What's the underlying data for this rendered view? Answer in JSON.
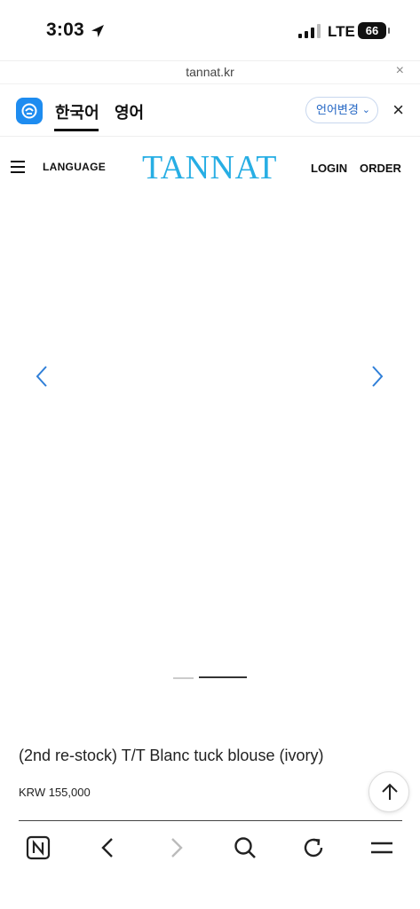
{
  "status_bar": {
    "time": "3:03",
    "network": "LTE",
    "battery": "66"
  },
  "url_bar": {
    "domain": "tannat.kr",
    "close": "×"
  },
  "translate_bar": {
    "tabs": [
      {
        "label": "한국어"
      },
      {
        "label": "영어"
      }
    ],
    "change_language": "언어변경",
    "close": "×"
  },
  "site_header": {
    "language_link": "LANGUAGE",
    "brand": "TANNAT",
    "login": "LOGIN",
    "order": "ORDER"
  },
  "gallery": {
    "slide_count": 2,
    "active_slide": 2
  },
  "product": {
    "title": "(2nd re-stock) T/T Blanc tuck blouse (ivory)",
    "price": "KRW 155,000"
  },
  "colors": {
    "brand": "#27aee4",
    "slider_arrow": "#2f7fd8",
    "papago": "#1e8cf0"
  },
  "toolbar": {
    "icons": [
      "naver-home-icon",
      "back-arrow-icon",
      "forward-arrow-icon",
      "search-icon",
      "refresh-icon",
      "menu-icon"
    ]
  }
}
